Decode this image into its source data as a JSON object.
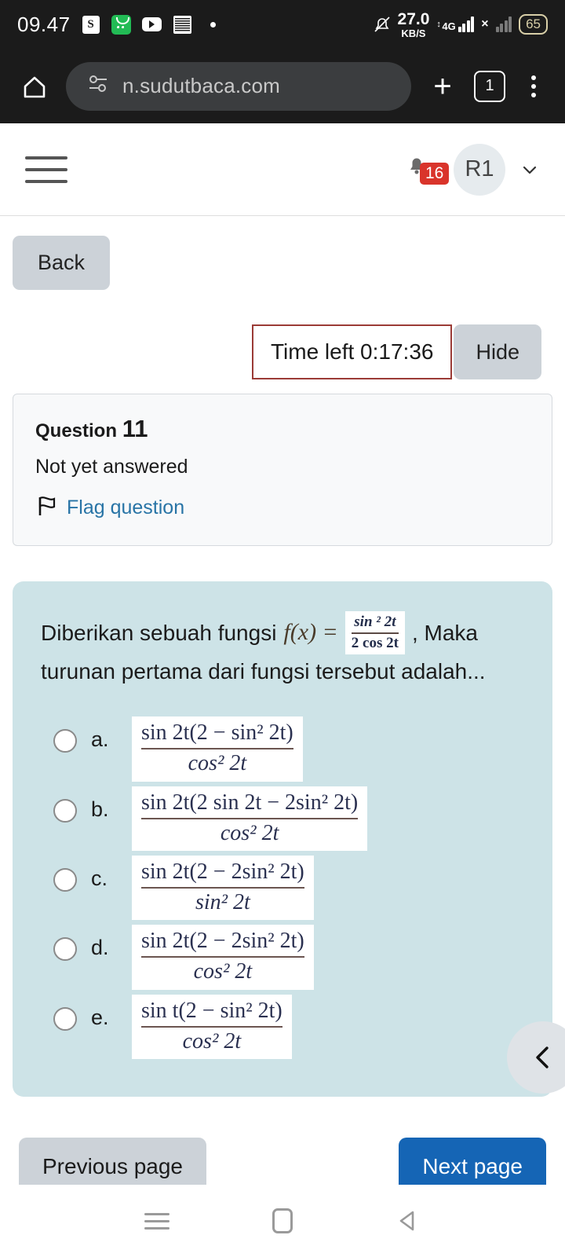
{
  "status_bar": {
    "clock": "09.47",
    "icons": [
      "shopee-icon",
      "green-app-icon",
      "youtube-icon",
      "qr-icon",
      "dot-icon"
    ],
    "data_rate_value": "27.0",
    "data_rate_unit": "KB/S",
    "network": "4G",
    "battery": "65",
    "bell": "bell-off-icon"
  },
  "browser": {
    "url": "n.sudutbaca.com",
    "tab_count": "1",
    "home_icon": "home-icon",
    "site_settings_icon": "site-settings-icon",
    "new_tab_icon": "plus-icon",
    "menu_icon": "kebab-menu-icon"
  },
  "site_header": {
    "menu_icon": "hamburger-icon",
    "notification_icon": "bell-icon",
    "notification_count": "16",
    "user_initials": "R1",
    "chevron_icon": "chevron-down-icon"
  },
  "toolbar": {
    "back_label": "Back",
    "timer_label": "Time left 0:17:36",
    "hide_label": "Hide"
  },
  "question_info": {
    "label": "Question",
    "number": "11",
    "state": "Not yet answered",
    "flag_label": "Flag question",
    "flag_icon": "flag-icon"
  },
  "question": {
    "text_before": "Diberikan sebuah fungsi",
    "fx_label": "f(x) =",
    "formula": {
      "numerator": "sin ² 2t",
      "denominator": "2 cos 2t"
    },
    "text_after": ", Maka",
    "text_line2": "turunan pertama dari fungsi tersebut adalah..."
  },
  "options": [
    {
      "letter": "a.",
      "numerator": "sin 2t(2 − sin² 2t)",
      "denominator": "cos² 2t",
      "selected": false
    },
    {
      "letter": "b.",
      "numerator": "sin 2t(2 sin 2t − 2sin² 2t)",
      "denominator": "cos² 2t",
      "selected": false
    },
    {
      "letter": "c.",
      "numerator": "sin 2t(2 − 2sin² 2t)",
      "denominator": "sin² 2t",
      "selected": false
    },
    {
      "letter": "d.",
      "numerator": "sin 2t(2 − 2sin² 2t)",
      "denominator": "cos² 2t",
      "selected": false
    },
    {
      "letter": "e.",
      "numerator": "sin t(2 − sin² 2t)",
      "denominator": "cos² 2t",
      "selected": false
    }
  ],
  "pagination": {
    "previous_label": "Previous page",
    "next_label": "Next page",
    "fab_icon": "chevron-left-icon"
  },
  "android_nav": {
    "recents_icon": "recents-icon",
    "home_icon": "home-square-icon",
    "back_icon": "back-triangle-icon"
  },
  "colors": {
    "accent_blue": "#1565b5",
    "card_bg": "#cde3e7",
    "badge_red": "#d9342b",
    "timer_border": "#9b3b36",
    "link_blue": "#2874a6"
  }
}
